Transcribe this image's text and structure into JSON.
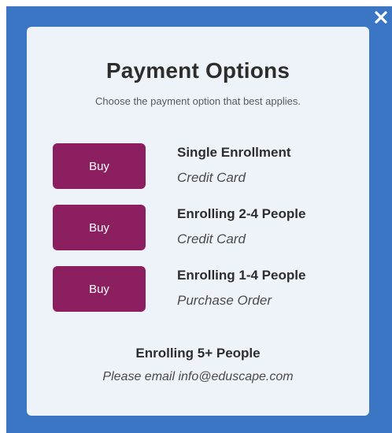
{
  "modal": {
    "close_icon": "close-icon",
    "title": "Payment Options",
    "subtitle": "Choose the payment option that best applies.",
    "options": [
      {
        "button_label": "Buy",
        "title": "Single Enrollment",
        "method": "Credit Card"
      },
      {
        "button_label": "Buy",
        "title": "Enrolling 2-4 People",
        "method": "Credit Card"
      },
      {
        "button_label": "Buy",
        "title": "Enrolling 1-4 People",
        "method": "Purchase Order"
      }
    ],
    "bulk": {
      "title": "Enrolling 5+ People",
      "note": "Please email info@eduscape.com"
    }
  },
  "colors": {
    "overlay": "#3a76c4",
    "modal_bg": "#eef3fa",
    "button": "#8c1f5f"
  }
}
